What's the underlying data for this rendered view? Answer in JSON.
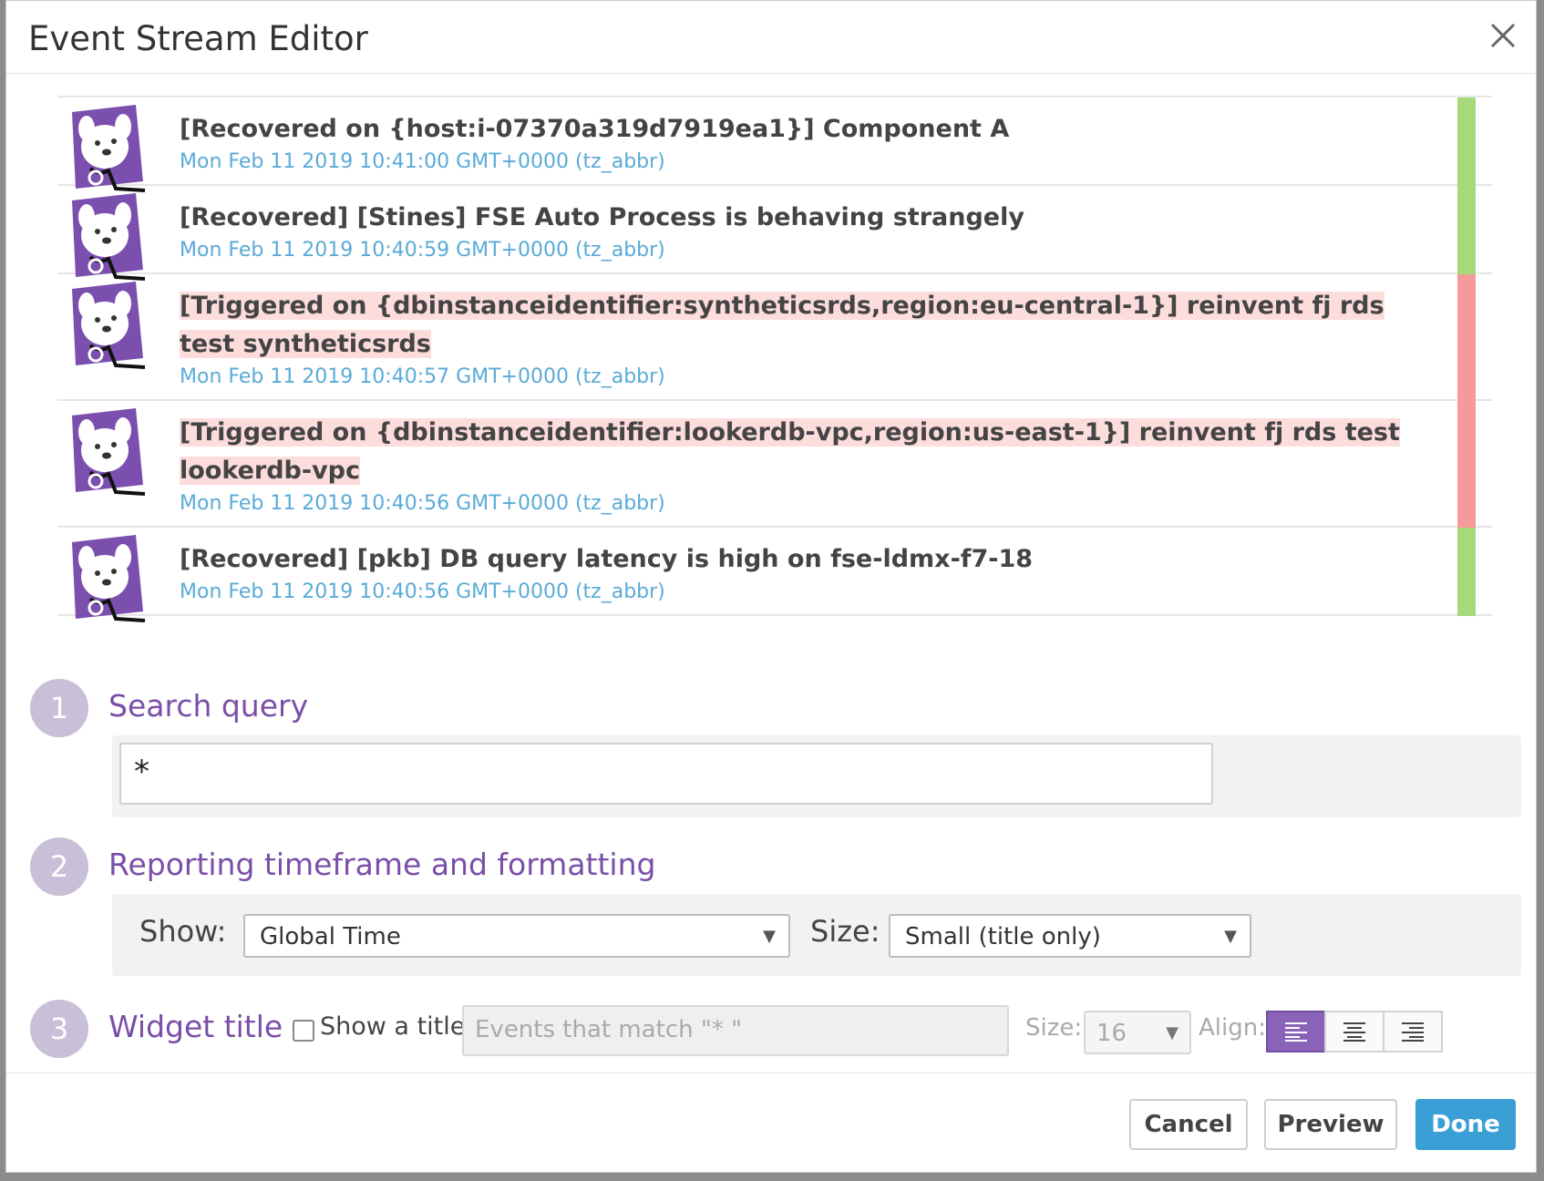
{
  "dialog": {
    "title": "Event Stream Editor"
  },
  "events": [
    {
      "title": "[Recovered on {host:i-07370a319d7919ea1}] Component A",
      "time": "Mon Feb 11 2019 10:41:00 GMT+0000 (tz_abbr)",
      "status": "recovered"
    },
    {
      "title": "[Recovered] [Stines] FSE Auto Process is behaving strangely",
      "time": "Mon Feb 11 2019 10:40:59 GMT+0000 (tz_abbr)",
      "status": "recovered"
    },
    {
      "title": "[Triggered on {dbinstanceidentifier:syntheticsrds,region:eu-central-1}] reinvent fj rds test syntheticsrds",
      "time": "Mon Feb 11 2019 10:40:57 GMT+0000 (tz_abbr)",
      "status": "triggered"
    },
    {
      "title": "[Triggered on {dbinstanceidentifier:lookerdb-vpc,region:us-east-1}] reinvent fj rds test lookerdb-vpc",
      "time": "Mon Feb 11 2019 10:40:56 GMT+0000 (tz_abbr)",
      "status": "triggered"
    },
    {
      "title": "[Recovered] [pkb] DB query latency is high on fse-ldmx-f7-18",
      "time": "Mon Feb 11 2019 10:40:56 GMT+0000 (tz_abbr)",
      "status": "recovered"
    }
  ],
  "colors": {
    "recovered": "#a6d97a",
    "triggered": "#f59a9a",
    "accent": "#7a4fa8",
    "primary": "#3a9fd5"
  },
  "steps": {
    "query": {
      "number": "1",
      "label": "Search query",
      "value": "*"
    },
    "timeframe": {
      "number": "2",
      "label": "Reporting timeframe and formatting",
      "show_label": "Show:",
      "show_value": "Global Time",
      "size_label": "Size:",
      "size_value": "Small (title only)"
    },
    "widget_title": {
      "number": "3",
      "label": "Widget title",
      "checkbox_label": "Show a title:",
      "checked": false,
      "title_placeholder": "Events that match \"* \"",
      "size_label": "Size:",
      "size_value": "16",
      "align_label": "Align:",
      "align_selected": "left"
    }
  },
  "footer": {
    "cancel": "Cancel",
    "preview": "Preview",
    "done": "Done"
  }
}
